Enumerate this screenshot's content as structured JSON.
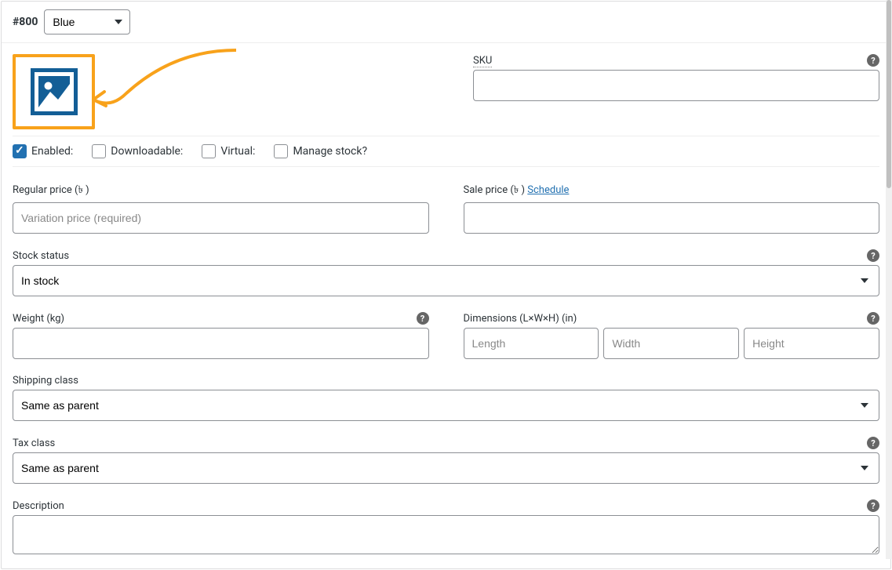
{
  "header": {
    "variation_id": "#800",
    "attribute_value": "Blue"
  },
  "sku": {
    "label": "SKU"
  },
  "checkboxes": {
    "enabled": {
      "label": "Enabled:",
      "checked": true
    },
    "downloadable": {
      "label": "Downloadable:",
      "checked": false
    },
    "virtual": {
      "label": "Virtual:",
      "checked": false
    },
    "manage_stock": {
      "label": "Manage stock?",
      "checked": false
    }
  },
  "pricing": {
    "regular_label": "Regular price (৳ )",
    "regular_placeholder": "Variation price (required)",
    "sale_label": "Sale price (৳ )",
    "schedule_text": "Schedule"
  },
  "stock": {
    "label": "Stock status",
    "value": "In stock"
  },
  "weight": {
    "label": "Weight (kg)"
  },
  "dimensions": {
    "label": "Dimensions (L×W×H) (in)",
    "length_placeholder": "Length",
    "width_placeholder": "Width",
    "height_placeholder": "Height"
  },
  "shipping_class": {
    "label": "Shipping class",
    "value": "Same as parent"
  },
  "tax_class": {
    "label": "Tax class",
    "value": "Same as parent"
  },
  "description": {
    "label": "Description"
  }
}
